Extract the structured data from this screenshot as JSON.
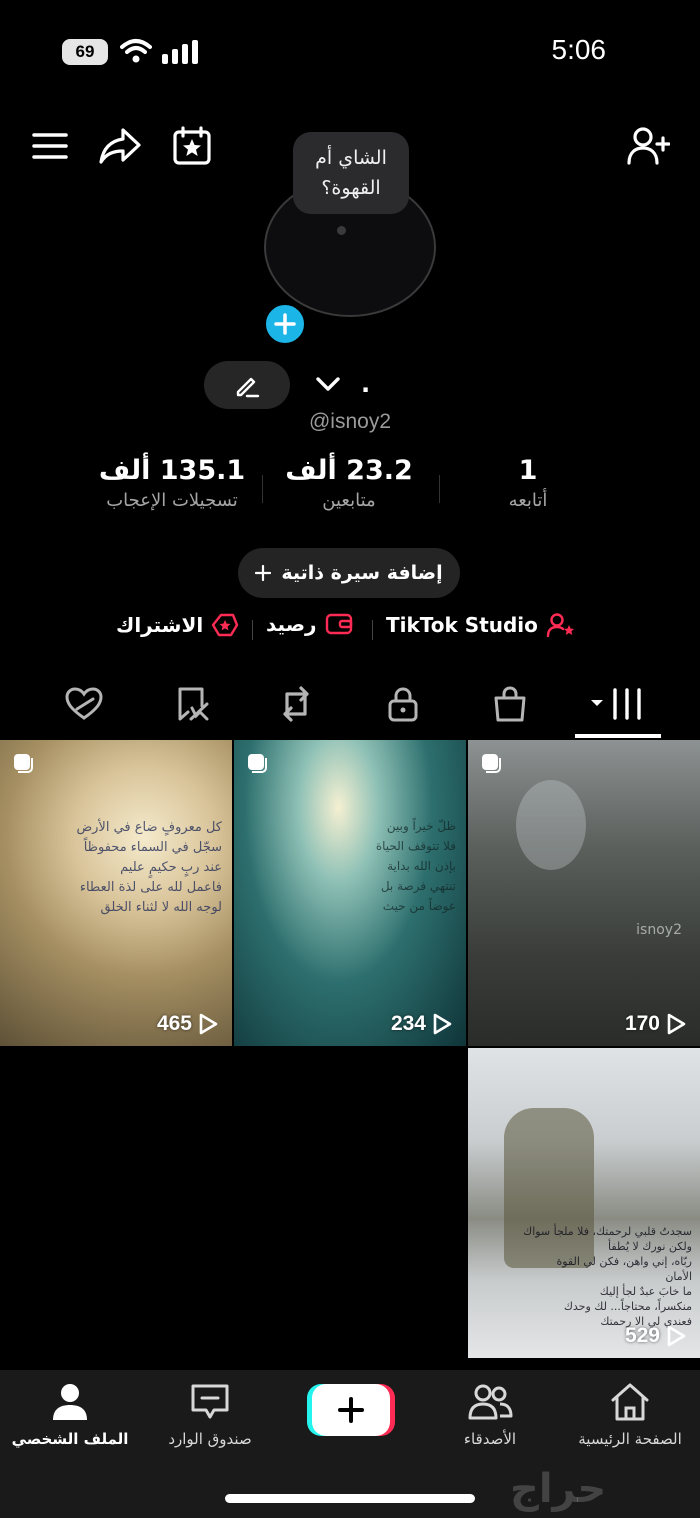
{
  "status_bar": {
    "battery": "69",
    "time": "5:06"
  },
  "profile": {
    "bubble_text": "الشاي أم القهوة؟",
    "name": ".",
    "handle": "@isnoy2",
    "stats": [
      {
        "value": "135.1 ألف",
        "label": "تسجيلات الإعجاب"
      },
      {
        "value": "23.2 ألف",
        "label": "متابعين"
      },
      {
        "value": "1",
        "label": "أتابعه"
      }
    ],
    "add_bio": "إضافة سيرة ذاتية"
  },
  "links": {
    "subscription": "الاشتراك",
    "balance": "رصيد",
    "studio": "TikTok Studio"
  },
  "videos": [
    {
      "views": "465",
      "overlay": [
        "كل معروفٍ ضاع في الأرض",
        "سجّل في السماء محفوظاً",
        "عند ربٍ حكيمٍ عليم",
        "فاعمل لله على لذة العطاء",
        "لوجه الله لا لثناء الخلق"
      ]
    },
    {
      "views": "234",
      "overlay": [
        "ظلّ خيراً وبين",
        "فلا تتوقف الحياة",
        "بإذن الله بداية",
        "تنتهي فرصة بل",
        "عوضاً من حيث"
      ]
    },
    {
      "views": "170",
      "overlay": [
        "isnoy2"
      ]
    },
    {
      "views": "529",
      "overlay": [
        "سجدتُ قلبي لرحمتك، فلا ملجأ سواك",
        "ولكن نورك لا يُطفأ",
        "ربّاه، إني واهن، فكن لي القوة",
        "الأمان",
        "ما خابَ عبدٌ لجأ إليك",
        "منكسراً، محتاجاً... لك وحدك",
        "فعندي لي الا رحمتك"
      ]
    }
  ],
  "nav": {
    "home": "الصفحة الرئيسية",
    "friends": "الأصدقاء",
    "inbox": "صندوق الوارد",
    "profile": "الملف الشخصي"
  },
  "watermark": "حراج",
  "colors": {
    "accent_blue": "#1bb5e8",
    "accent_pink": "#fe2c55",
    "accent_cyan": "#25f4ee"
  }
}
